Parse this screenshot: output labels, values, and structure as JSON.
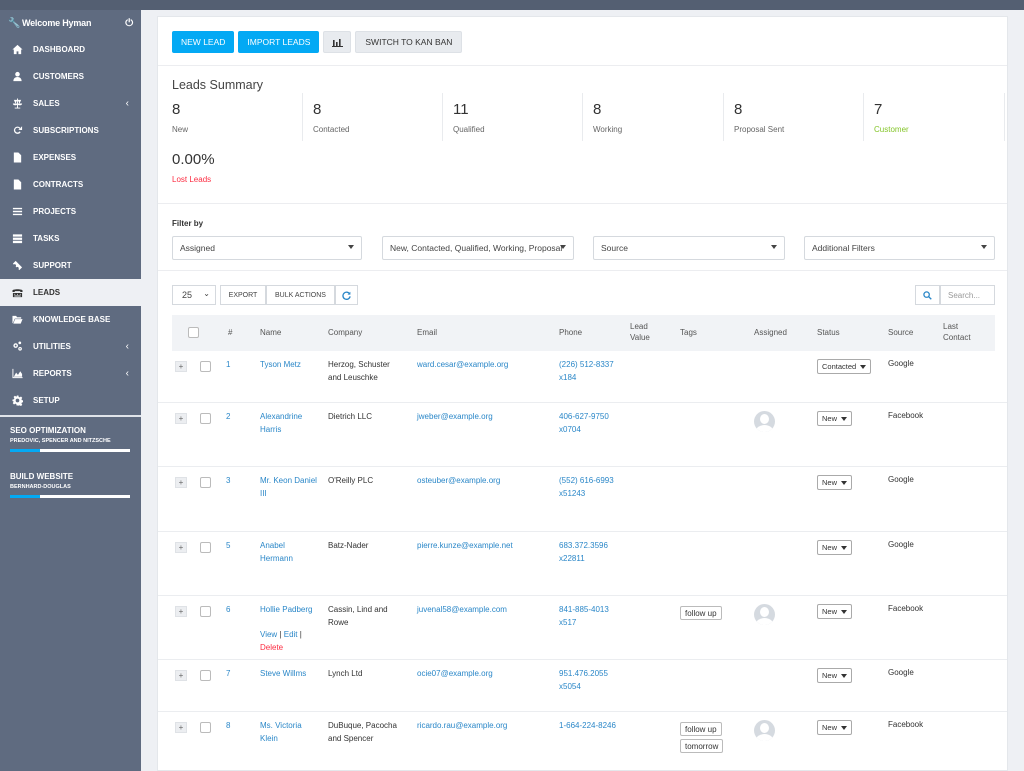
{
  "sidebar": {
    "welcome": "Welcome Hyman",
    "items": [
      {
        "label": "Dashboard",
        "icon": "home-icon"
      },
      {
        "label": "Customers",
        "icon": "user-icon"
      },
      {
        "label": "Sales",
        "icon": "scale-icon",
        "chevron": true
      },
      {
        "label": "Subscriptions",
        "icon": "refresh-icon"
      },
      {
        "label": "Expenses",
        "icon": "file-text-icon"
      },
      {
        "label": "Contracts",
        "icon": "file-icon"
      },
      {
        "label": "Projects",
        "icon": "bars-icon"
      },
      {
        "label": "Tasks",
        "icon": "tasks-icon"
      },
      {
        "label": "Support",
        "icon": "ticket-icon"
      },
      {
        "label": "Leads",
        "icon": "tty-icon",
        "active": true
      },
      {
        "label": "Knowledge Base",
        "icon": "folder-open-icon"
      },
      {
        "label": "Utilities",
        "icon": "cogs-icon",
        "chevron": true
      },
      {
        "label": "Reports",
        "icon": "area-chart-icon",
        "chevron": true
      },
      {
        "label": "Setup",
        "icon": "gear-icon"
      }
    ],
    "projects": [
      {
        "title": "SEO OPTIMIZATION",
        "client": "PREDOVIC, SPENCER AND NITZSCHE",
        "progress": 0.25
      },
      {
        "title": "BUILD WEBSITE",
        "client": "BERNHARD-DOUGLAS",
        "progress": 0.25
      }
    ]
  },
  "toolbar": {
    "new_lead": "NEW LEAD",
    "import_leads": "IMPORT LEADS",
    "chart_icon": "bar-chart-icon",
    "switch_kanban": "SWITCH TO KAN BAN"
  },
  "summary": {
    "title": "Leads Summary",
    "stats": [
      {
        "value": "8",
        "label": "New",
        "color": "#666666"
      },
      {
        "value": "8",
        "label": "Contacted",
        "color": "#666666"
      },
      {
        "value": "11",
        "label": "Qualified",
        "color": "#666666"
      },
      {
        "value": "8",
        "label": "Working",
        "color": "#666666"
      },
      {
        "value": "8",
        "label": "Proposal Sent",
        "color": "#666666"
      },
      {
        "value": "7",
        "label": "Customer",
        "color": "#84c529"
      }
    ],
    "lost": {
      "value": "0.00%",
      "label": "Lost Leads",
      "color": "#fc2d42"
    }
  },
  "filters": {
    "label": "Filter by",
    "assigned": "Assigned",
    "statuses": "New, Contacted, Qualified, Working, Proposal Sent",
    "source": "Source",
    "additional": "Additional Filters"
  },
  "table_controls": {
    "page_size": "25",
    "export": "EXPORT",
    "bulk_actions": "BULK ACTIONS",
    "search_placeholder": "Search..."
  },
  "table": {
    "headers": {
      "num": "#",
      "name": "Name",
      "company": "Company",
      "email": "Email",
      "phone": "Phone",
      "lead_value": "Lead Value",
      "tags": "Tags",
      "assigned": "Assigned",
      "status": "Status",
      "source": "Source",
      "last_contact": "Last Contact"
    },
    "row_actions": {
      "view": "View",
      "edit": "Edit",
      "delete": "Delete"
    },
    "rows": [
      {
        "id": "1",
        "name": "Tyson Metz",
        "company": "Herzog, Schuster and Leuschke",
        "email": "ward.cesar@example.org",
        "phone": "(226) 512-8337 x184",
        "tags": [],
        "assigned": false,
        "status": "Contacted",
        "source": "Google"
      },
      {
        "id": "2",
        "name": "Alexandrine Harris",
        "company": "Dietrich LLC",
        "email": "jweber@example.org",
        "phone": "406-627-9750 x0704",
        "tags": [],
        "assigned": true,
        "status": "New",
        "source": "Facebook"
      },
      {
        "id": "3",
        "name": "Mr. Keon Daniel III",
        "company": "O'Reilly PLC",
        "email": "osteuber@example.org",
        "phone": "(552) 616-6993 x51243",
        "tags": [],
        "assigned": false,
        "status": "New",
        "source": "Google"
      },
      {
        "id": "5",
        "name": "Anabel Hermann",
        "company": "Batz-Nader",
        "email": "pierre.kunze@example.net",
        "phone": "683.372.3596 x22811",
        "tags": [],
        "assigned": false,
        "status": "New",
        "source": "Google"
      },
      {
        "id": "6",
        "name": "Hollie Padberg",
        "company": "Cassin, Lind and Rowe",
        "email": "juvenal58@example.com",
        "phone": "841-885-4013 x517",
        "tags": [
          "follow up"
        ],
        "assigned": true,
        "status": "New",
        "source": "Facebook",
        "show_actions": true
      },
      {
        "id": "7",
        "name": "Steve Willms",
        "company": "Lynch Ltd",
        "email": "ocie07@example.org",
        "phone": "951.476.2055 x5054",
        "tags": [],
        "assigned": false,
        "status": "New",
        "source": "Google"
      },
      {
        "id": "8",
        "name": "Ms. Victoria Klein",
        "company": "DuBuque, Pacocha and Spencer",
        "email": "ricardo.rau@example.org",
        "phone": "1-664-224-8246",
        "tags": [
          "follow up",
          "tomorrow"
        ],
        "assigned": true,
        "status": "New",
        "source": "Facebook"
      }
    ]
  }
}
